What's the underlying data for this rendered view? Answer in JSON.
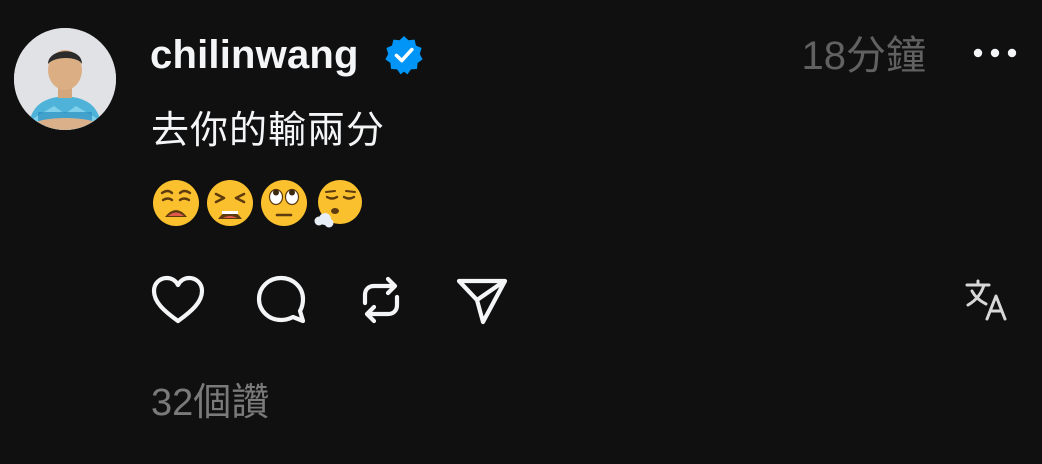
{
  "post": {
    "username": "chilinwang",
    "verified": true,
    "timestamp": "18分鐘",
    "text": "去你的輸兩分",
    "emojis": [
      "weary-face-icon",
      "tired-face-icon",
      "face-with-rolling-eyes-icon",
      "face-exhaling-icon"
    ],
    "likes": "32個讚"
  },
  "actions": [
    "like-heart-icon",
    "reply-bubble-icon",
    "repost-arrows-icon",
    "share-send-icon",
    "translate-icon"
  ],
  "colors": {
    "background": "#101010",
    "primary_text": "#f3f5f7",
    "secondary_text": "#616161",
    "verified_badge": "#0095f6",
    "emoji_yellow": "#fbc02d"
  }
}
